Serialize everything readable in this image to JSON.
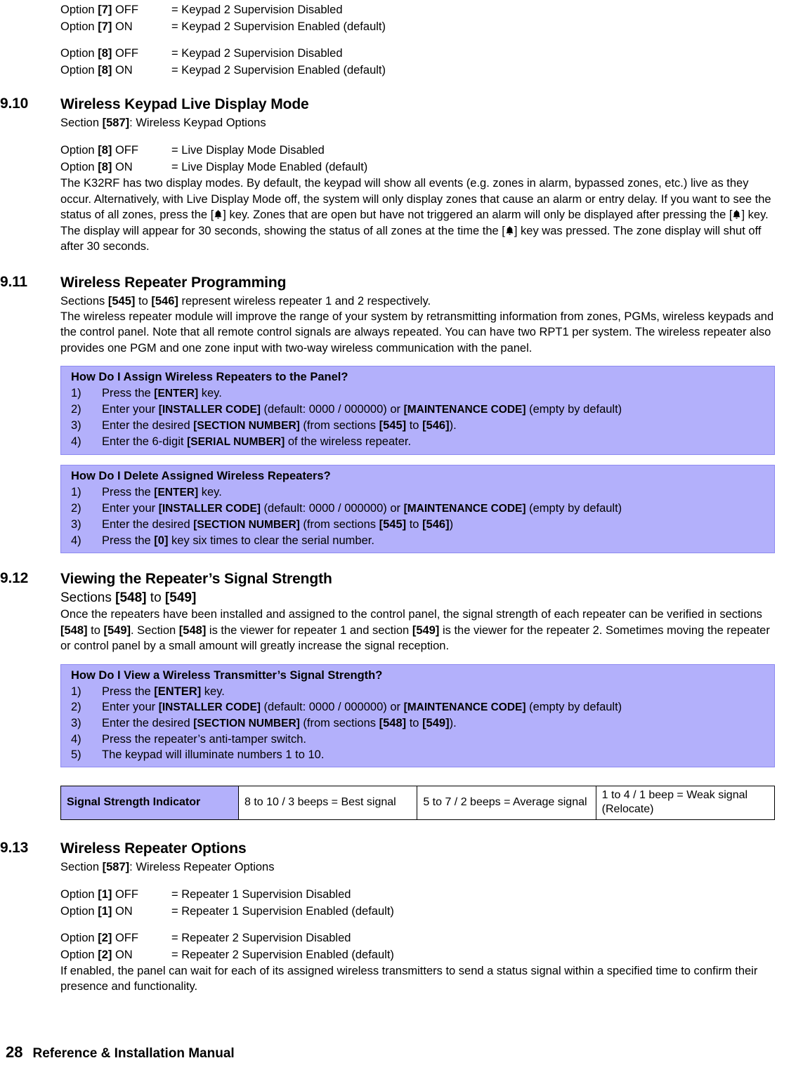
{
  "top_options": [
    {
      "left_prefix": "Option ",
      "left_bold": "[7]",
      "left_suffix": " OFF",
      "right": "= Keypad 2 Supervision Disabled"
    },
    {
      "left_prefix": "Option ",
      "left_bold": "[7]",
      "left_suffix": " ON",
      "right": "= Keypad 2 Supervision Enabled (default)"
    },
    {
      "left_prefix": "Option ",
      "left_bold": "[8]",
      "left_suffix": " OFF",
      "right": "= Keypad 2 Supervision Disabled"
    },
    {
      "left_prefix": "Option ",
      "left_bold": "[8]",
      "left_suffix": " ON",
      "right": "= Keypad 2 Supervision Enabled (default)"
    }
  ],
  "section_9_10": {
    "number": "9.10",
    "title": "Wireless Keypad Live Display Mode",
    "subtitle_prefix": "Section ",
    "subtitle_bold": "[587]",
    "subtitle_suffix": ": Wireless Keypad Options",
    "options": [
      {
        "left_prefix": "Option ",
        "left_bold": "[8]",
        "left_suffix": " OFF",
        "right": "= Live Display Mode Disabled"
      },
      {
        "left_prefix": "Option ",
        "left_bold": "[8]",
        "left_suffix": " ON",
        "right": "= Live Display Mode Enabled (default)"
      }
    ],
    "paragraph_part1": "The K32RF has two display modes. By default, the keypad will show all events (e.g. zones in alarm, bypassed zones, etc.) live as they occur. Alternatively, with Live Display Mode off, the system will only display zones that cause an alarm or entry delay. If you want to see the status of all zones, press the [",
    "paragraph_part2": "] key. Zones that are open but have not triggered an alarm will only be displayed after pressing the [",
    "paragraph_part3": "] key. The display will appear for 30 seconds, showing the status of all zones at the time the [",
    "paragraph_part4": "] key was pressed. The zone display will shut off after 30 seconds."
  },
  "section_9_11": {
    "number": "9.11",
    "title": "Wireless Repeater Programming",
    "line1_a": "Sections ",
    "line1_b": "[545]",
    "line1_c": " to ",
    "line1_d": "[546]",
    "line1_e": " represent wireless repeater 1 and 2 respectively.",
    "line2": "The wireless repeater module will improve the range of your system by retransmitting information from zones, PGMs, wireless keypads and the control panel. Note that all remote control signals are always repeated. You can have two RPT1 per system. The wireless repeater also provides one PGM and one zone input with two-way wireless communication with the panel.",
    "box_assign": {
      "title": "How Do I Assign Wireless Repeaters to the Panel?",
      "items": [
        {
          "num": "1)",
          "parts": [
            {
              "t": "Press the ",
              "s": "n"
            },
            {
              "t": "[ENTER]",
              "s": "sc"
            },
            {
              "t": " key.",
              "s": "n"
            }
          ]
        },
        {
          "num": "2)",
          "parts": [
            {
              "t": "Enter your ",
              "s": "n"
            },
            {
              "t": "[INSTALLER CODE]",
              "s": "sc"
            },
            {
              "t": " (default: 0000 / 000000) or ",
              "s": "n"
            },
            {
              "t": "[MAINTENANCE CODE]",
              "s": "sc"
            },
            {
              "t": " (empty by default)",
              "s": "n"
            }
          ]
        },
        {
          "num": "3)",
          "parts": [
            {
              "t": "Enter the desired ",
              "s": "n"
            },
            {
              "t": "[SECTION NUMBER]",
              "s": "sc"
            },
            {
              "t": " (from sections ",
              "s": "n"
            },
            {
              "t": "[545]",
              "s": "b"
            },
            {
              "t": " to ",
              "s": "n"
            },
            {
              "t": "[546]",
              "s": "b"
            },
            {
              "t": ").",
              "s": "n"
            }
          ]
        },
        {
          "num": "4)",
          "parts": [
            {
              "t": "Enter the 6-digit ",
              "s": "n"
            },
            {
              "t": "[SERIAL NUMBER]",
              "s": "sc"
            },
            {
              "t": " of the wireless repeater.",
              "s": "n"
            }
          ]
        }
      ]
    },
    "box_delete": {
      "title": "How Do I Delete Assigned Wireless Repeaters?",
      "items": [
        {
          "num": "1)",
          "parts": [
            {
              "t": "Press the ",
              "s": "n"
            },
            {
              "t": "[ENTER]",
              "s": "sc"
            },
            {
              "t": " key.",
              "s": "n"
            }
          ]
        },
        {
          "num": "2)",
          "parts": [
            {
              "t": "Enter your ",
              "s": "n"
            },
            {
              "t": "[INSTALLER CODE]",
              "s": "sc"
            },
            {
              "t": " (default: 0000 / 000000) or ",
              "s": "n"
            },
            {
              "t": "[MAINTENANCE CODE]",
              "s": "sc"
            },
            {
              "t": " (empty by default)",
              "s": "n"
            }
          ]
        },
        {
          "num": "3)",
          "parts": [
            {
              "t": "Enter the desired ",
              "s": "n"
            },
            {
              "t": "[SECTION NUMBER]",
              "s": "sc"
            },
            {
              "t": " (from sections ",
              "s": "n"
            },
            {
              "t": "[545]",
              "s": "b"
            },
            {
              "t": " to ",
              "s": "n"
            },
            {
              "t": "[546]",
              "s": "b"
            },
            {
              "t": ")",
              "s": "n"
            }
          ]
        },
        {
          "num": "4)",
          "parts": [
            {
              "t": "Press the ",
              "s": "n"
            },
            {
              "t": "[0]",
              "s": "b"
            },
            {
              "t": " key six times to clear the serial number.",
              "s": "n"
            }
          ]
        }
      ]
    }
  },
  "section_9_12": {
    "number": "9.12",
    "title": "Viewing the Repeater’s Signal Strength",
    "sub_a": "Sections ",
    "sub_b": "[548]",
    "sub_c": " to ",
    "sub_d": "[549]",
    "paragraph_a": "Once the repeaters have been installed and assigned to the control panel, the signal strength of each repeater can be verified in sections ",
    "paragraph_b": "[548]",
    "paragraph_c": " to ",
    "paragraph_d": "[549]",
    "paragraph_e": ". Section ",
    "paragraph_f": "[548]",
    "paragraph_g": " is the viewer for repeater 1 and section ",
    "paragraph_h": "[549]",
    "paragraph_i": " is the viewer for the repeater 2. Sometimes moving the repeater or control panel by a small amount will greatly increase the signal reception.",
    "box_view": {
      "title": "How Do I View a Wireless Transmitter’s Signal Strength?",
      "items": [
        {
          "num": "1)",
          "parts": [
            {
              "t": "Press the ",
              "s": "n"
            },
            {
              "t": "[ENTER]",
              "s": "b"
            },
            {
              "t": " key.",
              "s": "n"
            }
          ]
        },
        {
          "num": "2)",
          "parts": [
            {
              "t": "Enter your ",
              "s": "n"
            },
            {
              "t": "[INSTALLER CODE]",
              "s": "sc"
            },
            {
              "t": " (default: 0000 / 000000) or ",
              "s": "n"
            },
            {
              "t": "[MAINTENANCE CODE]",
              "s": "sc"
            },
            {
              "t": " (empty by default)",
              "s": "n"
            }
          ]
        },
        {
          "num": "3)",
          "parts": [
            {
              "t": "Enter the desired ",
              "s": "n"
            },
            {
              "t": "[SECTION NUMBER]",
              "s": "sc"
            },
            {
              "t": " (from sections ",
              "s": "n"
            },
            {
              "t": "[548]",
              "s": "b"
            },
            {
              "t": " to ",
              "s": "n"
            },
            {
              "t": "[549]",
              "s": "b"
            },
            {
              "t": ").",
              "s": "n"
            }
          ]
        },
        {
          "num": "4)",
          "parts": [
            {
              "t": "Press the repeater’s anti-tamper switch.",
              "s": "n"
            }
          ]
        },
        {
          "num": "5)",
          "parts": [
            {
              "t": "The keypad will illuminate numbers 1 to 10.",
              "s": "n"
            }
          ]
        }
      ]
    },
    "signal_table": {
      "header": "Signal Strength Indicator",
      "cells": [
        "8 to 10 / 3 beeps = Best signal",
        "5 to 7 / 2 beeps = Average signal",
        "1 to 4 / 1 beep = Weak signal (Relocate)"
      ]
    }
  },
  "section_9_13": {
    "number": "9.13",
    "title": "Wireless Repeater Options",
    "subtitle_prefix": "Section ",
    "subtitle_bold": "[587]",
    "subtitle_suffix": ": Wireless Repeater Options",
    "options_a": [
      {
        "left_prefix": "Option ",
        "left_bold": "[1]",
        "left_suffix": " OFF",
        "right": "= Repeater 1 Supervision Disabled"
      },
      {
        "left_prefix": "Option ",
        "left_bold": "[1]",
        "left_suffix": " ON",
        "right": "= Repeater 1 Supervision Enabled (default)"
      }
    ],
    "options_b": [
      {
        "left_prefix": "Option ",
        "left_bold": "[2]",
        "left_suffix": " OFF",
        "right": "= Repeater 2 Supervision Disabled"
      },
      {
        "left_prefix": "Option ",
        "left_bold": "[2]",
        "left_suffix": " ON",
        "right": "= Repeater 2 Supervision Enabled (default)"
      }
    ],
    "closing": "If enabled, the panel can wait for each of its assigned wireless transmitters to send a status signal within a specified time to confirm their presence and functionality."
  },
  "footer": {
    "page_number": "28",
    "text": "Reference & Installation Manual"
  },
  "colors": {
    "box_fill": "#b3b0fb",
    "box_border": "#8d8af0"
  },
  "icons": {
    "bell_key": "bell-icon"
  }
}
